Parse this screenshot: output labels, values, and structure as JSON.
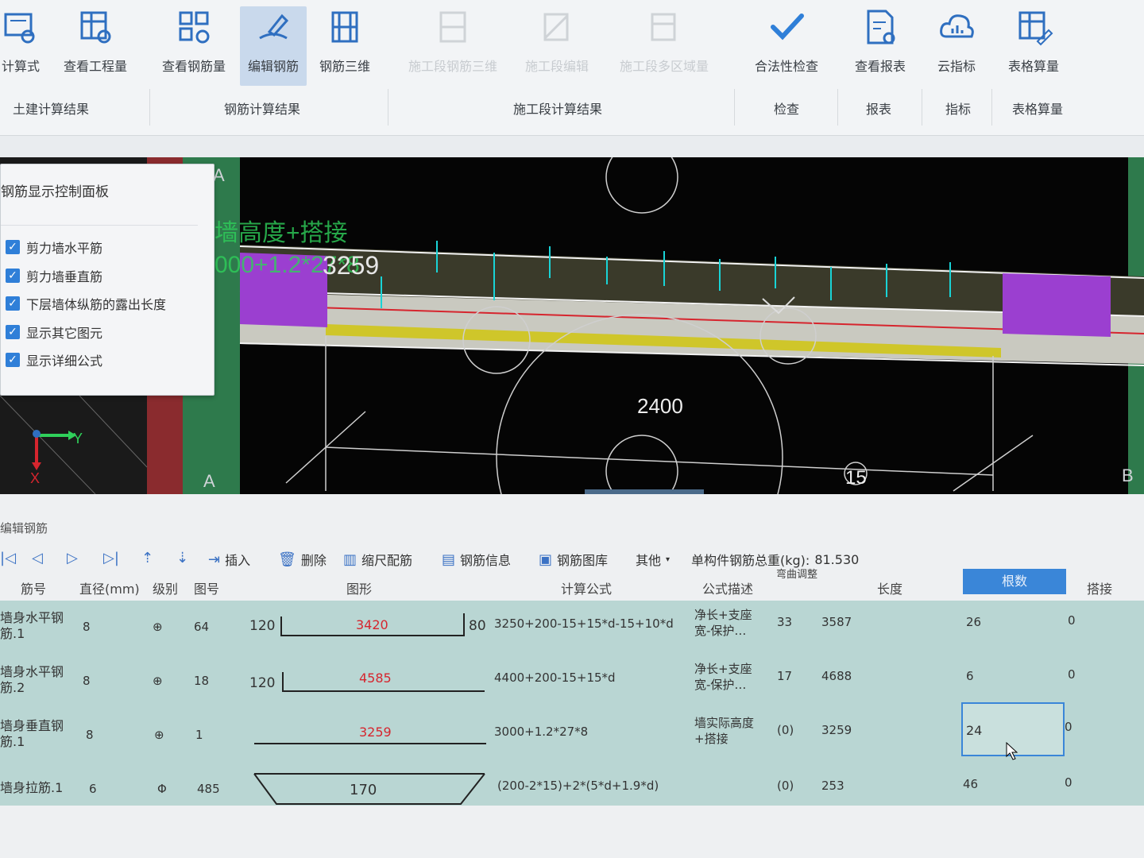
{
  "ribbon": {
    "buttons": [
      {
        "label": "计算式",
        "icon": "calc-formula-icon",
        "state": "normal"
      },
      {
        "label": "查看工程量",
        "icon": "view-quantity-icon",
        "state": "normal"
      },
      {
        "label": "查看钢筋量",
        "icon": "view-rebar-icon",
        "state": "normal"
      },
      {
        "label": "编辑钢筋",
        "icon": "edit-rebar-icon",
        "state": "active"
      },
      {
        "label": "钢筋三维",
        "icon": "rebar-3d-icon",
        "state": "normal"
      },
      {
        "label": "施工段钢筋三维",
        "icon": "stage-rebar-3d-icon",
        "state": "disabled"
      },
      {
        "label": "施工段编辑",
        "icon": "stage-edit-icon",
        "state": "disabled"
      },
      {
        "label": "施工段多区域量",
        "icon": "stage-region-icon",
        "state": "disabled"
      },
      {
        "label": "合法性检查",
        "icon": "check-icon",
        "state": "normal"
      },
      {
        "label": "查看报表",
        "icon": "report-icon",
        "state": "normal"
      },
      {
        "label": "云指标",
        "icon": "cloud-index-icon",
        "state": "normal"
      },
      {
        "label": "表格算量",
        "icon": "table-calc-icon",
        "state": "normal"
      }
    ],
    "groups": [
      "土建计算结果",
      "钢筋计算结果",
      "施工段计算结果",
      "检查",
      "报表",
      "指标",
      "表格算量"
    ]
  },
  "viewport": {
    "axis_label_a_top": "A",
    "axis_label_a_bottom": "A",
    "axis_label_b": "B",
    "overlay_text_1": "墙高度+搭接",
    "overlay_text_2": "000+1.2*27*8",
    "overlay_value": "3259",
    "dimension_center": "2400",
    "grid_number": "15",
    "axis_x": "X",
    "axis_y": "Y"
  },
  "control_panel": {
    "title": "钢筋显示控制面板",
    "options": [
      {
        "label": "剪力墙水平筋",
        "checked": true
      },
      {
        "label": "剪力墙垂直筋",
        "checked": true
      },
      {
        "label": "下层墙体纵筋的露出长度",
        "checked": true
      },
      {
        "label": "显示其它图元",
        "checked": true
      },
      {
        "label": "显示详细公式",
        "checked": true
      }
    ]
  },
  "editor": {
    "title": "编辑钢筋",
    "toolbar": {
      "insert": "插入",
      "delete": "删除",
      "scale_config": "缩尺配筋",
      "rebar_info": "钢筋信息",
      "rebar_library": "钢筋图库",
      "other": "其他",
      "total_weight_label": "单构件钢筋总重(kg):",
      "total_weight_value": "81.530"
    },
    "columns": {
      "bar_no": "筋号",
      "diameter": "直径(mm)",
      "grade": "级别",
      "shape_no": "图号",
      "shape": "图形",
      "formula": "计算公式",
      "formula_desc": "公式描述",
      "bend": "弯曲调整",
      "length": "长度",
      "root_count": "根数",
      "lap": "搭接"
    },
    "rows": [
      {
        "name_1": "墙身水平钢",
        "name_2": "筋.1",
        "diameter": "8",
        "grade": "⊕",
        "shape_no": "64",
        "shape_left": "120",
        "shape_mid": "3420",
        "shape_right": "80",
        "formula": "3250+200-15+15*d-15+10*d",
        "desc_1": "净长+支座",
        "desc_2": "宽-保护…",
        "bend": "33",
        "length": "3587",
        "count": "26",
        "lap": "0"
      },
      {
        "name_1": "墙身水平钢",
        "name_2": "筋.2",
        "diameter": "8",
        "grade": "⊕",
        "shape_no": "18",
        "shape_left": "120",
        "shape_mid": "4585",
        "formula": "4400+200-15+15*d",
        "desc_1": "净长+支座",
        "desc_2": "宽-保护…",
        "bend": "17",
        "length": "4688",
        "count": "6",
        "lap": "0"
      },
      {
        "name_1": "墙身垂直钢",
        "name_2": "筋.1",
        "diameter": "8",
        "grade": "⊕",
        "shape_no": "1",
        "shape_mid": "3259",
        "formula": "3000+1.2*27*8",
        "desc_1": "墙实际高度",
        "desc_2": "+搭接",
        "bend": "(0)",
        "length": "3259",
        "count": "24",
        "lap": "0"
      },
      {
        "name_1": "墙身拉筋.1",
        "name_2": "",
        "diameter": "6",
        "grade": "Φ",
        "shape_no": "485",
        "shape_mid": "170",
        "formula": "(200-2*15)+2*(5*d+1.9*d)",
        "desc_1": "",
        "desc_2": "",
        "bend": "(0)",
        "length": "253",
        "count": "46",
        "lap": "0"
      }
    ]
  },
  "colors": {
    "accent": "#3a86d8",
    "row_bg": "#b9d6d3",
    "viewport_bg": "#050505",
    "rebar_purple": "#9b3fd0",
    "rebar_cyan": "#19d3d6",
    "dimension_red": "#d6252e"
  }
}
